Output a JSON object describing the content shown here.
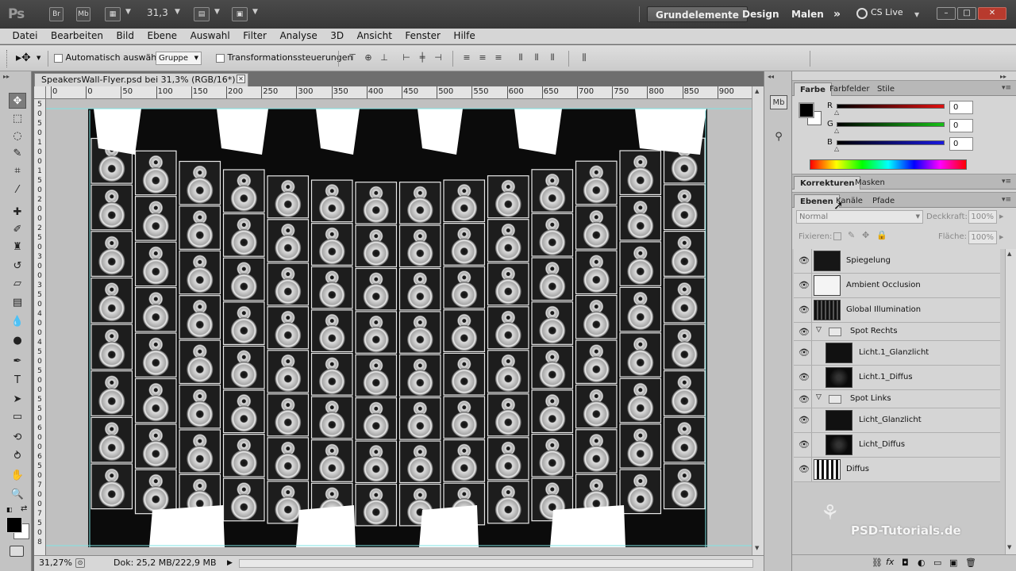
{
  "app": {
    "logo": "Ps",
    "bridge_btn": "Br",
    "minibridge_btn": "Mb",
    "zoom": "31,3",
    "workspaces": [
      "Grundelemente",
      "Design",
      "Malen"
    ],
    "more": "»",
    "cs_live": "CS Live",
    "window_buttons": [
      "–",
      "□",
      "✕"
    ]
  },
  "menu": [
    "Datei",
    "Bearbeiten",
    "Bild",
    "Ebene",
    "Auswahl",
    "Filter",
    "Analyse",
    "3D",
    "Ansicht",
    "Fenster",
    "Hilfe"
  ],
  "options": {
    "auto_select_label": "Automatisch auswählen:",
    "auto_select_value": "Gruppe",
    "transform_label": "Transformationssteuerungen"
  },
  "document": {
    "tab_title": "SpeakersWall-Flyer.psd bei 31,3% (RGB/16*) *",
    "close": "✕",
    "ruler_h": [
      "0",
      "0",
      "50",
      "100",
      "150",
      "200",
      "250",
      "300",
      "350",
      "400",
      "450",
      "500",
      "550",
      "600",
      "650",
      "700",
      "750",
      "800",
      "850",
      "900"
    ],
    "ruler_v": [
      "5",
      "0",
      "5",
      "0",
      "1",
      "0",
      "0",
      "1",
      "5",
      "0",
      "2",
      "0",
      "0",
      "2",
      "5",
      "0",
      "3",
      "0",
      "0",
      "3",
      "5",
      "0",
      "4",
      "0",
      "0",
      "4",
      "5",
      "0",
      "5",
      "0",
      "0",
      "5",
      "5",
      "0",
      "6",
      "0",
      "0",
      "6",
      "5",
      "0",
      "7",
      "0",
      "0",
      "7",
      "5",
      "0",
      "8"
    ]
  },
  "status": {
    "zoom": "31,27%",
    "doc": "Dok: 25,2 MB/222,9 MB"
  },
  "panels": {
    "color_tabs": [
      "Farbe",
      "Farbfelder",
      "Stile"
    ],
    "color": {
      "r_label": "R",
      "g_label": "G",
      "b_label": "B",
      "r": "0",
      "g": "0",
      "b": "0",
      "r_color": "#d81414",
      "g_color": "#19b319",
      "b_color": "#1c1cd9"
    },
    "adjust_tabs": [
      "Korrekturen",
      "Masken"
    ],
    "layer_tabs": [
      "Ebenen",
      "Kanäle",
      "Pfade"
    ],
    "blend_mode": "Normal",
    "opacity_label": "Deckkraft:",
    "opacity": "100%",
    "lock_label": "Fixieren:",
    "fill_label": "Fläche:",
    "fill": "100%",
    "layers": [
      {
        "name": "Spiegelung",
        "type": "layer"
      },
      {
        "name": "Ambient Occlusion",
        "type": "layer"
      },
      {
        "name": "Global Illumination",
        "type": "layer"
      },
      {
        "name": "Spot Rechts",
        "type": "group"
      },
      {
        "name": "Licht.1_Glanzlicht",
        "type": "child"
      },
      {
        "name": "Licht.1_Diffus",
        "type": "child"
      },
      {
        "name": "Spot Links",
        "type": "group"
      },
      {
        "name": "Licht_Glanzlicht",
        "type": "child"
      },
      {
        "name": "Licht_Diffus",
        "type": "child"
      },
      {
        "name": "Diffus",
        "type": "layer"
      }
    ]
  },
  "watermark": "PSD-Tutorials.de"
}
